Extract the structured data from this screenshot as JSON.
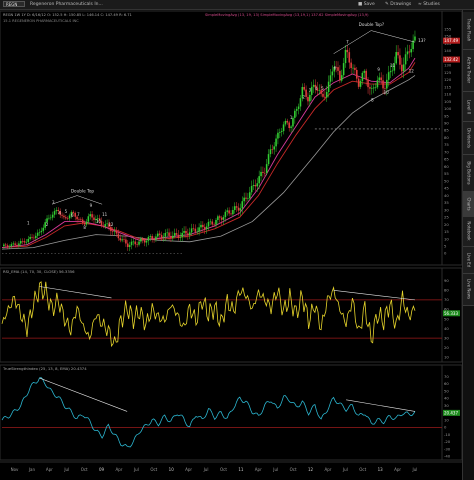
{
  "toolbar": {
    "symbol": "REGN",
    "company": "Regeneron Pharmaceuticals In...",
    "save": "Save",
    "drawings": "Drawings",
    "studies": "Studies"
  },
  "sidebar": {
    "tabs": [
      "Trade Flash",
      "Active Trader",
      "Level II",
      "Dividends",
      "Big Buttons",
      "Charts",
      "Notebook",
      "Live Ed",
      "Live News"
    ],
    "active": "Charts"
  },
  "price_panel": {
    "header": "REGN 1W 1Y D: 6/16/12  O: 152.5  H: 150.85  L: 146.14  C: 147.49  R: 6.71",
    "header_studies": "SimpleMovingAvg (13, 19, 13)  SimpleMovingAvg (13,19,1) 137.62  SimpleMovingAvg (13,9)",
    "header_line2": "15.1 REGENERON PHARMACEUTICALS INC",
    "labels": {
      "double_top_1": "Double Top",
      "double_top_2": "Double Top?",
      "label_13q": "13?"
    },
    "last_badge": "147.49",
    "ma_badge": "132.42"
  },
  "rsi_panel": {
    "header": "RSI_EMA (14, 70, 30, CLOSE) 56.3356",
    "badge": "56.333"
  },
  "tsi_panel": {
    "header": "TrueStrengthIndex (25, 13, 8, EMA)  20.4374",
    "badge": "20.437"
  },
  "x_axis_labels": [
    "Nov",
    "Jan",
    "Apr",
    "Jul",
    "Oct",
    "09",
    "Apr",
    "Jul",
    "Oct",
    "10",
    "Apr",
    "Jul",
    "Oct",
    "11",
    "Apr",
    "Jul",
    "Oct",
    "12",
    "Apr",
    "Jul",
    "Oct",
    "13",
    "Apr",
    "Jul"
  ],
  "colors": {
    "price_up": "#32cd32",
    "price_down": "#e23b3b",
    "ma_short": "#d73a9a",
    "ma_mid": "#c62828",
    "ma_long": "#9a9a9a",
    "rsi": "#e6d42b",
    "tsi": "#2bb5cf",
    "level_line": "#9b1a1a",
    "badge_green": "#1e8c1e",
    "badge_red": "#b41e1e"
  },
  "chart_data": [
    {
      "type": "candlestick",
      "title": "REGN weekly",
      "y_tick_labels": [
        "155",
        "150",
        "145",
        "140",
        "135",
        "130",
        "125",
        "120",
        "115",
        "110",
        "105",
        "100",
        "95",
        "90",
        "85",
        "80",
        "75",
        "70",
        "65",
        "60",
        "55",
        "50",
        "45",
        "40",
        "35",
        "30",
        "25",
        "20",
        "15",
        "10",
        "5",
        "0"
      ],
      "ylim": [
        -8,
        162
      ],
      "close_series": [
        [
          0,
          5
        ],
        [
          4,
          6
        ],
        [
          8,
          9
        ],
        [
          12,
          14
        ],
        [
          14,
          22
        ],
        [
          16,
          27
        ],
        [
          18,
          30
        ],
        [
          20,
          23
        ],
        [
          22,
          28
        ],
        [
          24,
          25
        ],
        [
          26,
          20
        ],
        [
          28,
          26
        ],
        [
          30,
          24
        ],
        [
          32,
          20
        ],
        [
          34,
          19
        ],
        [
          36,
          14
        ],
        [
          38,
          10
        ],
        [
          40,
          6
        ],
        [
          42,
          7
        ],
        [
          44,
          8
        ],
        [
          48,
          11
        ],
        [
          52,
          13
        ],
        [
          56,
          12
        ],
        [
          60,
          15
        ],
        [
          64,
          18
        ],
        [
          68,
          22
        ],
        [
          72,
          28
        ],
        [
          76,
          32
        ],
        [
          80,
          45
        ],
        [
          84,
          58
        ],
        [
          86,
          72
        ],
        [
          88,
          80
        ],
        [
          90,
          90
        ],
        [
          92,
          88
        ],
        [
          94,
          98
        ],
        [
          96,
          113
        ],
        [
          98,
          107
        ],
        [
          100,
          118
        ],
        [
          102,
          108
        ],
        [
          104,
          112
        ],
        [
          106,
          132
        ],
        [
          108,
          120
        ],
        [
          110,
          140
        ],
        [
          112,
          128
        ],
        [
          114,
          118
        ],
        [
          116,
          125
        ],
        [
          118,
          110
        ],
        [
          120,
          121
        ],
        [
          122,
          115
        ],
        [
          124,
          124
        ],
        [
          126,
          137
        ],
        [
          128,
          128
        ],
        [
          130,
          141
        ],
        [
          132,
          147
        ]
      ],
      "ma_short": [
        [
          0,
          4
        ],
        [
          8,
          6
        ],
        [
          14,
          13
        ],
        [
          20,
          22
        ],
        [
          26,
          22
        ],
        [
          32,
          19
        ],
        [
          38,
          14
        ],
        [
          44,
          9
        ],
        [
          52,
          11
        ],
        [
          60,
          13
        ],
        [
          68,
          19
        ],
        [
          76,
          28
        ],
        [
          82,
          45
        ],
        [
          88,
          68
        ],
        [
          94,
          88
        ],
        [
          100,
          108
        ],
        [
          106,
          118
        ],
        [
          112,
          124
        ],
        [
          118,
          119
        ],
        [
          124,
          118
        ],
        [
          130,
          128
        ],
        [
          132,
          135
        ]
      ],
      "ma_mid": [
        [
          0,
          4
        ],
        [
          8,
          5
        ],
        [
          14,
          11
        ],
        [
          20,
          19
        ],
        [
          26,
          21
        ],
        [
          32,
          19
        ],
        [
          38,
          15
        ],
        [
          44,
          10
        ],
        [
          52,
          10
        ],
        [
          60,
          12
        ],
        [
          68,
          17
        ],
        [
          76,
          25
        ],
        [
          82,
          40
        ],
        [
          88,
          62
        ],
        [
          94,
          82
        ],
        [
          100,
          100
        ],
        [
          106,
          113
        ],
        [
          112,
          119
        ],
        [
          118,
          117
        ],
        [
          124,
          117
        ],
        [
          130,
          125
        ],
        [
          132,
          132
        ]
      ],
      "ma_long": [
        [
          0,
          3
        ],
        [
          10,
          4
        ],
        [
          20,
          9
        ],
        [
          30,
          13
        ],
        [
          40,
          12
        ],
        [
          50,
          9
        ],
        [
          60,
          8
        ],
        [
          70,
          12
        ],
        [
          80,
          22
        ],
        [
          90,
          42
        ],
        [
          100,
          68
        ],
        [
          106,
          84
        ],
        [
          112,
          97
        ],
        [
          118,
          106
        ],
        [
          124,
          113
        ],
        [
          130,
          120
        ],
        [
          132,
          123
        ]
      ],
      "reference_level": 86,
      "wave_labels_1": [
        "1",
        "2",
        "3",
        "4",
        "5",
        "6",
        "7",
        "8",
        "9",
        "10",
        "11",
        "12"
      ],
      "wave_labels_2": [
        "1",
        "2",
        "3",
        "4",
        "5",
        "6",
        "7",
        "8",
        "9",
        "10",
        "11",
        "12"
      ]
    },
    {
      "type": "line",
      "title": "RSI_EMA (14, 70, 30, CLOSE)",
      "y_tick_labels": [
        "90",
        "80",
        "70",
        "60",
        "50",
        "40",
        "30",
        "20",
        "10"
      ],
      "ylim": [
        5,
        95
      ],
      "levels": [
        70,
        30
      ],
      "values": [
        [
          0,
          45
        ],
        [
          2,
          60
        ],
        [
          4,
          72
        ],
        [
          6,
          55
        ],
        [
          8,
          40
        ],
        [
          10,
          65
        ],
        [
          12,
          82
        ],
        [
          14,
          78
        ],
        [
          16,
          60
        ],
        [
          18,
          70
        ],
        [
          20,
          50
        ],
        [
          22,
          38
        ],
        [
          24,
          62
        ],
        [
          26,
          42
        ],
        [
          28,
          30
        ],
        [
          30,
          55
        ],
        [
          32,
          45
        ],
        [
          34,
          38
        ],
        [
          36,
          22
        ],
        [
          38,
          48
        ],
        [
          40,
          62
        ],
        [
          42,
          50
        ],
        [
          44,
          58
        ],
        [
          46,
          44
        ],
        [
          48,
          60
        ],
        [
          50,
          52
        ],
        [
          52,
          48
        ],
        [
          54,
          65
        ],
        [
          56,
          55
        ],
        [
          58,
          40
        ],
        [
          60,
          62
        ],
        [
          62,
          48
        ],
        [
          64,
          70
        ],
        [
          66,
          55
        ],
        [
          68,
          62
        ],
        [
          70,
          45
        ],
        [
          72,
          68
        ],
        [
          74,
          58
        ],
        [
          76,
          80
        ],
        [
          78,
          75
        ],
        [
          80,
          60
        ],
        [
          82,
          78
        ],
        [
          84,
          70
        ],
        [
          86,
          62
        ],
        [
          88,
          80
        ],
        [
          90,
          58
        ],
        [
          92,
          72
        ],
        [
          94,
          55
        ],
        [
          96,
          74
        ],
        [
          98,
          48
        ],
        [
          100,
          65
        ],
        [
          102,
          40
        ],
        [
          104,
          70
        ],
        [
          106,
          80
        ],
        [
          108,
          60
        ],
        [
          110,
          45
        ],
        [
          112,
          70
        ],
        [
          114,
          35
        ],
        [
          116,
          62
        ],
        [
          118,
          28
        ],
        [
          120,
          55
        ],
        [
          122,
          48
        ],
        [
          124,
          66
        ],
        [
          126,
          42
        ],
        [
          128,
          72
        ],
        [
          130,
          52
        ],
        [
          132,
          62
        ]
      ],
      "divergence_lines": [
        [
          [
            12,
            84
          ],
          [
            35,
            72
          ]
        ],
        [
          [
            106,
            80
          ],
          [
            132,
            70
          ]
        ]
      ]
    },
    {
      "type": "line",
      "title": "TrueStrengthIndex (25, 13, 8, EMA)",
      "y_tick_labels": [
        "70",
        "60",
        "50",
        "40",
        "30",
        "20",
        "10",
        "0",
        "-10",
        "-20",
        "-30",
        "-40"
      ],
      "ylim": [
        -45,
        75
      ],
      "levels": [
        0
      ],
      "values": [
        [
          0,
          10
        ],
        [
          3,
          18
        ],
        [
          6,
          30
        ],
        [
          9,
          55
        ],
        [
          12,
          68
        ],
        [
          14,
          60
        ],
        [
          16,
          48
        ],
        [
          18,
          42
        ],
        [
          20,
          30
        ],
        [
          22,
          22
        ],
        [
          24,
          12
        ],
        [
          26,
          18
        ],
        [
          28,
          8
        ],
        [
          30,
          -5
        ],
        [
          32,
          -12
        ],
        [
          34,
          2
        ],
        [
          36,
          -10
        ],
        [
          38,
          -22
        ],
        [
          40,
          -28
        ],
        [
          42,
          -20
        ],
        [
          44,
          -5
        ],
        [
          46,
          2
        ],
        [
          48,
          10
        ],
        [
          50,
          5
        ],
        [
          52,
          15
        ],
        [
          54,
          8
        ],
        [
          56,
          20
        ],
        [
          58,
          12
        ],
        [
          60,
          0
        ],
        [
          62,
          18
        ],
        [
          64,
          10
        ],
        [
          66,
          25
        ],
        [
          68,
          14
        ],
        [
          70,
          20
        ],
        [
          72,
          12
        ],
        [
          74,
          28
        ],
        [
          76,
          40
        ],
        [
          78,
          35
        ],
        [
          80,
          22
        ],
        [
          82,
          15
        ],
        [
          84,
          30
        ],
        [
          86,
          38
        ],
        [
          88,
          25
        ],
        [
          90,
          42
        ],
        [
          92,
          38
        ],
        [
          94,
          28
        ],
        [
          96,
          35
        ],
        [
          98,
          20
        ],
        [
          100,
          30
        ],
        [
          102,
          10
        ],
        [
          104,
          25
        ],
        [
          106,
          40
        ],
        [
          108,
          32
        ],
        [
          110,
          25
        ],
        [
          112,
          30
        ],
        [
          114,
          15
        ],
        [
          116,
          20
        ],
        [
          118,
          5
        ],
        [
          120,
          10
        ],
        [
          122,
          8
        ],
        [
          124,
          15
        ],
        [
          126,
          12
        ],
        [
          128,
          20
        ],
        [
          130,
          18
        ],
        [
          132,
          20
        ]
      ],
      "divergence_lines": [
        [
          [
            12,
            68
          ],
          [
            40,
            22
          ]
        ],
        [
          [
            110,
            38
          ],
          [
            132,
            22
          ]
        ]
      ]
    }
  ]
}
